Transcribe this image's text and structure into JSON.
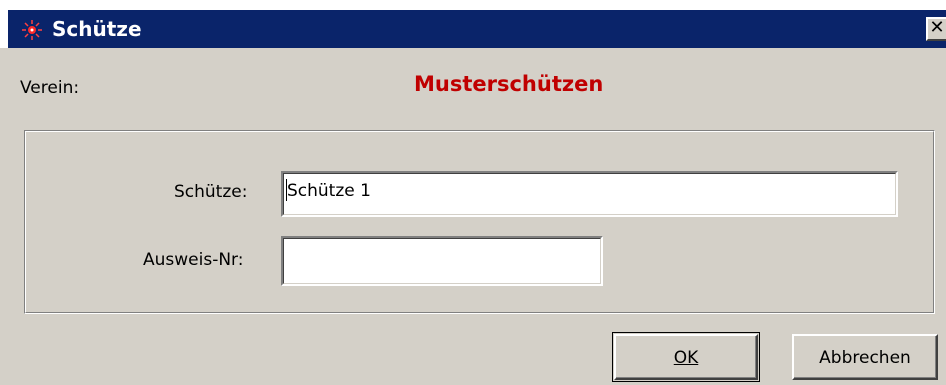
{
  "window": {
    "title": "Schütze",
    "icon": "target-icon",
    "close_glyph": "✕"
  },
  "club": {
    "label": "Verein:",
    "name": "Musterschützen",
    "name_color": "#c00000"
  },
  "form": {
    "shooter_label": "Schütze:",
    "shooter_value": "Schütze 1",
    "id_label": "Ausweis-Nr:",
    "id_value": ""
  },
  "buttons": {
    "ok": "OK",
    "cancel": "Abbrechen"
  },
  "colors": {
    "titlebar": "#0a246a",
    "window_bg": "#d4d0c8"
  }
}
